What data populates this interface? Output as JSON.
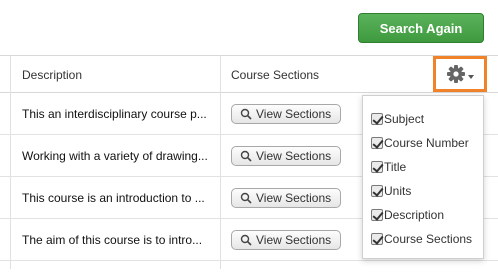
{
  "toolbar": {
    "search_again_label": "Search Again"
  },
  "table": {
    "headers": {
      "description": "Description",
      "course_sections": "Course Sections"
    },
    "rows": [
      {
        "description": "This an interdisciplinary course p...",
        "action": "View Sections"
      },
      {
        "description": "Working with a variety of drawing...",
        "action": "View Sections"
      },
      {
        "description": "This course is an introduction to ...",
        "action": "View Sections"
      },
      {
        "description": "The aim of this course is to intro...",
        "action": "View Sections"
      }
    ]
  },
  "column_menu": {
    "items": [
      {
        "label": "Subject",
        "checked": true
      },
      {
        "label": "Course Number",
        "checked": true
      },
      {
        "label": "Title",
        "checked": true
      },
      {
        "label": "Units",
        "checked": true
      },
      {
        "label": "Description",
        "checked": true
      },
      {
        "label": "Course Sections",
        "checked": true
      }
    ]
  },
  "colors": {
    "highlight": "#f0822a",
    "primary_button": "#4ca64c"
  },
  "icons": {
    "settings": "gear-icon",
    "view": "search-icon"
  }
}
